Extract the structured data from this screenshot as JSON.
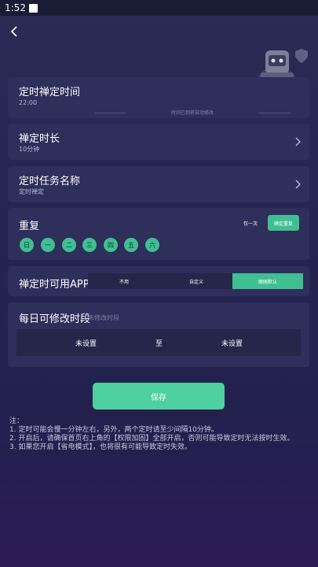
{
  "status": {
    "time": "1:52"
  },
  "hint_text": "时间已到将自动修改",
  "timed_zen": {
    "title": "定时禅定时间",
    "value": "22:00"
  },
  "duration": {
    "title": "禅定时长",
    "value": "10分钟"
  },
  "task_name": {
    "title": "定时任务名称",
    "value": "定时禅定"
  },
  "repeat": {
    "title": "重复",
    "once_label": "仅一次",
    "confirm_label": "确定重复",
    "days": [
      "日",
      "一",
      "二",
      "三",
      "四",
      "五",
      "六"
    ]
  },
  "apps": {
    "title": "禅定时可用APP",
    "options": [
      "不用",
      "自定义",
      "跟随默认"
    ],
    "selected": "跟随默认"
  },
  "modify": {
    "title": "每日可修改时段",
    "subtitle": "未修改时段",
    "start": "未设置",
    "separator": "至",
    "end": "未设置"
  },
  "save_label": "保存",
  "notes": [
    "注：",
    "1. 定时可能会慢一分钟左右，另外，两个定时请至少间隔10分钟。",
    "2. 开启后，请确保首页右上角的【权限加固】全部开启，否则可能导致定时无法按时生效。",
    "3. 如果您开启【省电模式】，也将很有可能导致定时失效。"
  ],
  "colors": {
    "accent": "#3fbf92",
    "card": "#2e2f5a",
    "background": "#262552"
  }
}
